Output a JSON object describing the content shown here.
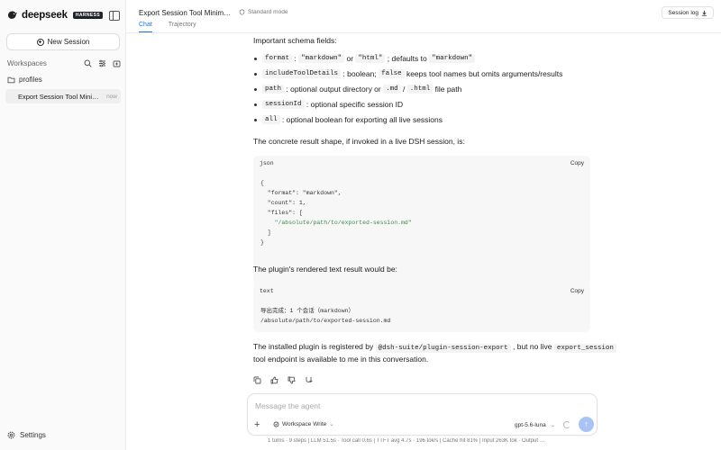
{
  "sidebar": {
    "brand": "deepseek",
    "badge": "HARNESS",
    "new_session_label": "New Session",
    "workspaces_label": "Workspaces",
    "folder_label": "profiles",
    "session_title": "Export Session Tool Minimal…",
    "session_time": "now",
    "settings_label": "Settings"
  },
  "header": {
    "title": "Export Session Tool Minimal E…",
    "mode_label": "Standard mode",
    "tabs": [
      {
        "label": "Chat",
        "active": true
      },
      {
        "label": "Trajectory",
        "active": false
      }
    ],
    "session_log_label": "Session log"
  },
  "message": {
    "intro": "Important schema fields:",
    "fields": [
      {
        "code": "format",
        "sep": " : ",
        "code2": "\"markdown\"",
        "mid": " or ",
        "code3": "\"html\"",
        "tail": " ; defaults to ",
        "code4": "\"markdown\""
      },
      {
        "code": "includeToolDetails",
        "text": " : boolean; ",
        "code2": "false",
        "tail": " keeps tool names but omits arguments/results"
      },
      {
        "code": "path",
        "text": " : optional output directory or ",
        "code2": ".md",
        "mid": " / ",
        "code3": ".html",
        "tail": " file path"
      },
      {
        "code": "sessionId",
        "text": " : optional specific session ID"
      },
      {
        "code": "all",
        "text": " : optional boolean for exporting all live sessions"
      }
    ],
    "shape_text": "The concrete result shape, if invoked in a live DSH session, is:",
    "json_lang": "json",
    "copy_label": "Copy",
    "json_lines": [
      "{",
      "  \"format\": \"markdown\",",
      "  \"count\": 1,",
      "  \"files\": [",
      "    \"/absolute/path/to/exported-session.md\"",
      "  ]",
      "}"
    ],
    "rendered_text": "The plugin's rendered text result would be:",
    "text_lang": "text",
    "text_lines": [
      "导出完成：1 个会话（markdown）",
      "/absolute/path/to/exported-session.md"
    ],
    "final_a": "The installed plugin is registered by ",
    "final_code": "@dsh-suite/plugin-session-export",
    "final_b": " , but no live ",
    "final_code2": "export_session",
    "final_c": "tool endpoint is available to me in this conversation."
  },
  "composer": {
    "placeholder": "Message the agent",
    "workspace_mode": "Workspace Write",
    "model": "gpt-5.6-luna",
    "stats": "1 turns · 9 steps   |   LLM 51.5s · Tool call 0.6s   |   TTFT avg 4.7s · 196 tok/s   |   Cache hit 81%   |   Input 263K tok · Output …"
  }
}
